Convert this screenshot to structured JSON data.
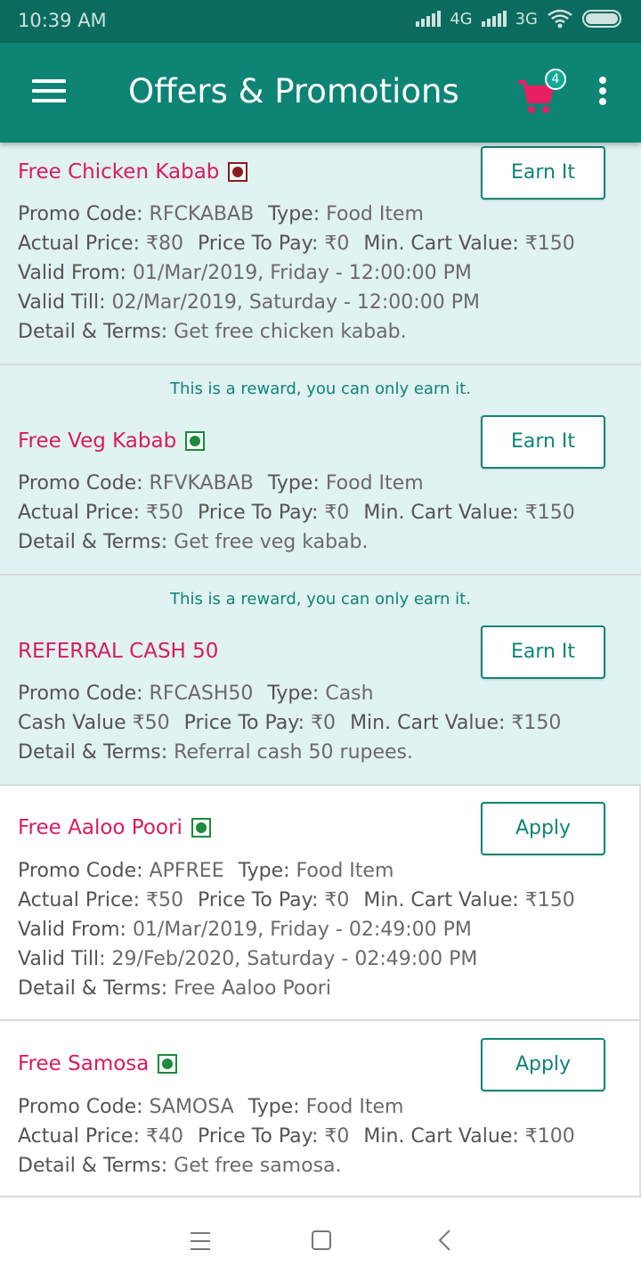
{
  "status_bar": {
    "time": "10:39 AM",
    "network_1": "4G",
    "network_2": "3G"
  },
  "app_bar": {
    "title": "Offers & Promotions",
    "cart_count": "4"
  },
  "labels": {
    "promo_code": "Promo Code:",
    "type": "Type:",
    "actual_price": "Actual Price:",
    "price_to_pay": "Price To Pay:",
    "min_cart_value": "Min. Cart Value:",
    "valid_from": "Valid From:",
    "valid_till": "Valid Till:",
    "detail_terms": "Detail & Terms:",
    "cash_value": "Cash Value"
  },
  "reward_note": "This is a reward, you can only earn it.",
  "offers": [
    {
      "name": "Free Chicken Kabab",
      "diet": "non-veg",
      "button": "Earn It",
      "promo_code": "RFCKABAB",
      "type": "Food Item",
      "actual_price": "₹80",
      "price_to_pay": "₹0",
      "min_cart_value": "₹150",
      "valid_from": "01/Mar/2019, Friday - 12:00:00 PM",
      "valid_till": "02/Mar/2019, Saturday - 12:00:00 PM",
      "detail": "Get free chicken kabab."
    },
    {
      "name": "Free Veg Kabab",
      "diet": "veg",
      "button": "Earn It",
      "promo_code": "RFVKABAB",
      "type": "Food Item",
      "actual_price": "₹50",
      "price_to_pay": "₹0",
      "min_cart_value": "₹150",
      "detail": "Get free veg kabab."
    },
    {
      "name": "REFERRAL CASH 50",
      "button": "Earn It",
      "promo_code": "RFCASH50",
      "type": "Cash",
      "cash_value": "₹50",
      "price_to_pay": "₹0",
      "min_cart_value": "₹150",
      "detail": "Referral cash 50 rupees."
    },
    {
      "name": "Free Aaloo Poori",
      "diet": "veg",
      "button": "Apply",
      "promo_code": "APFREE",
      "type": "Food Item",
      "actual_price": "₹50",
      "price_to_pay": "₹0",
      "min_cart_value": "₹150",
      "valid_from": "01/Mar/2019, Friday - 02:49:00 PM",
      "valid_till": "29/Feb/2020, Saturday - 02:49:00 PM",
      "detail": "Free Aaloo Poori"
    },
    {
      "name": "Free Samosa",
      "diet": "veg",
      "button": "Apply",
      "promo_code": "SAMOSA",
      "type": "Food Item",
      "actual_price": "₹40",
      "price_to_pay": "₹0",
      "min_cart_value": "₹100",
      "detail": "Get free samosa."
    }
  ],
  "colors": {
    "app_bar": "#0e8475",
    "status_bar": "#0b6b5f",
    "accent_pink": "#d81b60",
    "reward_bg": "#e0f2f1",
    "veg": "#1b8a3a",
    "non_veg": "#8b1c1c"
  }
}
